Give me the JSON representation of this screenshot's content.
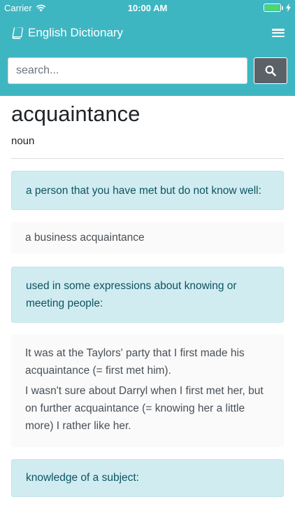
{
  "status": {
    "carrier": "Carrier",
    "time": "10:00 AM",
    "battery_level": 1.0,
    "battery_color": "#4cd964"
  },
  "header": {
    "icon": "book-icon",
    "title": "English Dictionary",
    "menu_icon": "hamburger-menu-icon",
    "brand_color": "#3eb6c2"
  },
  "search": {
    "placeholder": "search...",
    "value": "",
    "button_icon": "search-icon"
  },
  "entry": {
    "word": "acquaintance",
    "part_of_speech": "noun",
    "senses": [
      {
        "definition": "a person that you have met but do not know well:",
        "examples": [
          "a business acquaintance"
        ]
      },
      {
        "definition": "used in some expressions about knowing or meeting people:",
        "examples": [
          "It was at the Taylors' party that I first made his acquaintance (= first met him).",
          "I wasn't sure about Darryl when I first met her, but on further acquaintance (= knowing her a little more) I rather like her."
        ]
      },
      {
        "definition": "knowledge of a subject:",
        "examples": []
      }
    ]
  }
}
